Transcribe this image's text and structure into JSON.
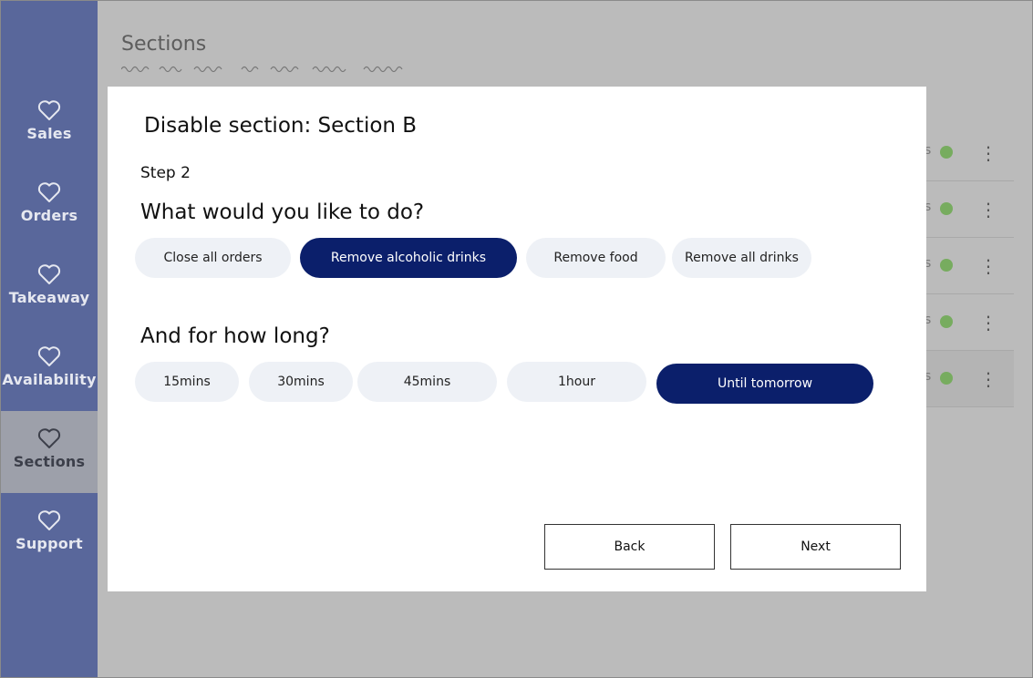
{
  "sidebar": {
    "items": [
      {
        "label": "Sales",
        "icon": "heart-icon",
        "active": false
      },
      {
        "label": "Orders",
        "icon": "heart-icon",
        "active": false
      },
      {
        "label": "Takeaway",
        "icon": "heart-icon",
        "active": false
      },
      {
        "label": "Availability",
        "icon": "heart-icon",
        "active": false
      },
      {
        "label": "Sections",
        "icon": "heart-icon",
        "active": true
      },
      {
        "label": "Support",
        "icon": "heart-icon",
        "active": false
      }
    ]
  },
  "page": {
    "title": "Sections",
    "rows": [
      {
        "status_color": "#77ac5f",
        "menu_icon": "vertical-dots-icon"
      },
      {
        "status_color": "#77ac5f",
        "menu_icon": "vertical-dots-icon"
      },
      {
        "status_color": "#77ac5f",
        "menu_icon": "vertical-dots-icon"
      },
      {
        "status_color": "#77ac5f",
        "menu_icon": "vertical-dots-icon"
      },
      {
        "status_color": "#77ac5f",
        "menu_icon": "vertical-dots-icon"
      }
    ]
  },
  "modal": {
    "title": "Disable section: Section B",
    "step": "Step 2",
    "question_action": "What would you like to do?",
    "actions": [
      {
        "label": "Close all orders",
        "selected": false
      },
      {
        "label": "Remove alcoholic drinks",
        "selected": true
      },
      {
        "label": "Remove food",
        "selected": false
      },
      {
        "label": "Remove all drinks",
        "selected": false
      }
    ],
    "question_duration": "And for how long?",
    "durations": [
      {
        "label": "15mins",
        "selected": false
      },
      {
        "label": "30mins",
        "selected": false
      },
      {
        "label": "45mins",
        "selected": false
      },
      {
        "label": "1hour",
        "selected": false
      },
      {
        "label": "Until tomorrow",
        "selected": true
      }
    ],
    "back_label": "Back",
    "next_label": "Next"
  },
  "colors": {
    "sidebar": "#59679b",
    "selected_chip": "#0b1f6b",
    "chip": "#eef1f6",
    "overlay": "#bbbbbb",
    "status_green": "#77ac5f"
  }
}
